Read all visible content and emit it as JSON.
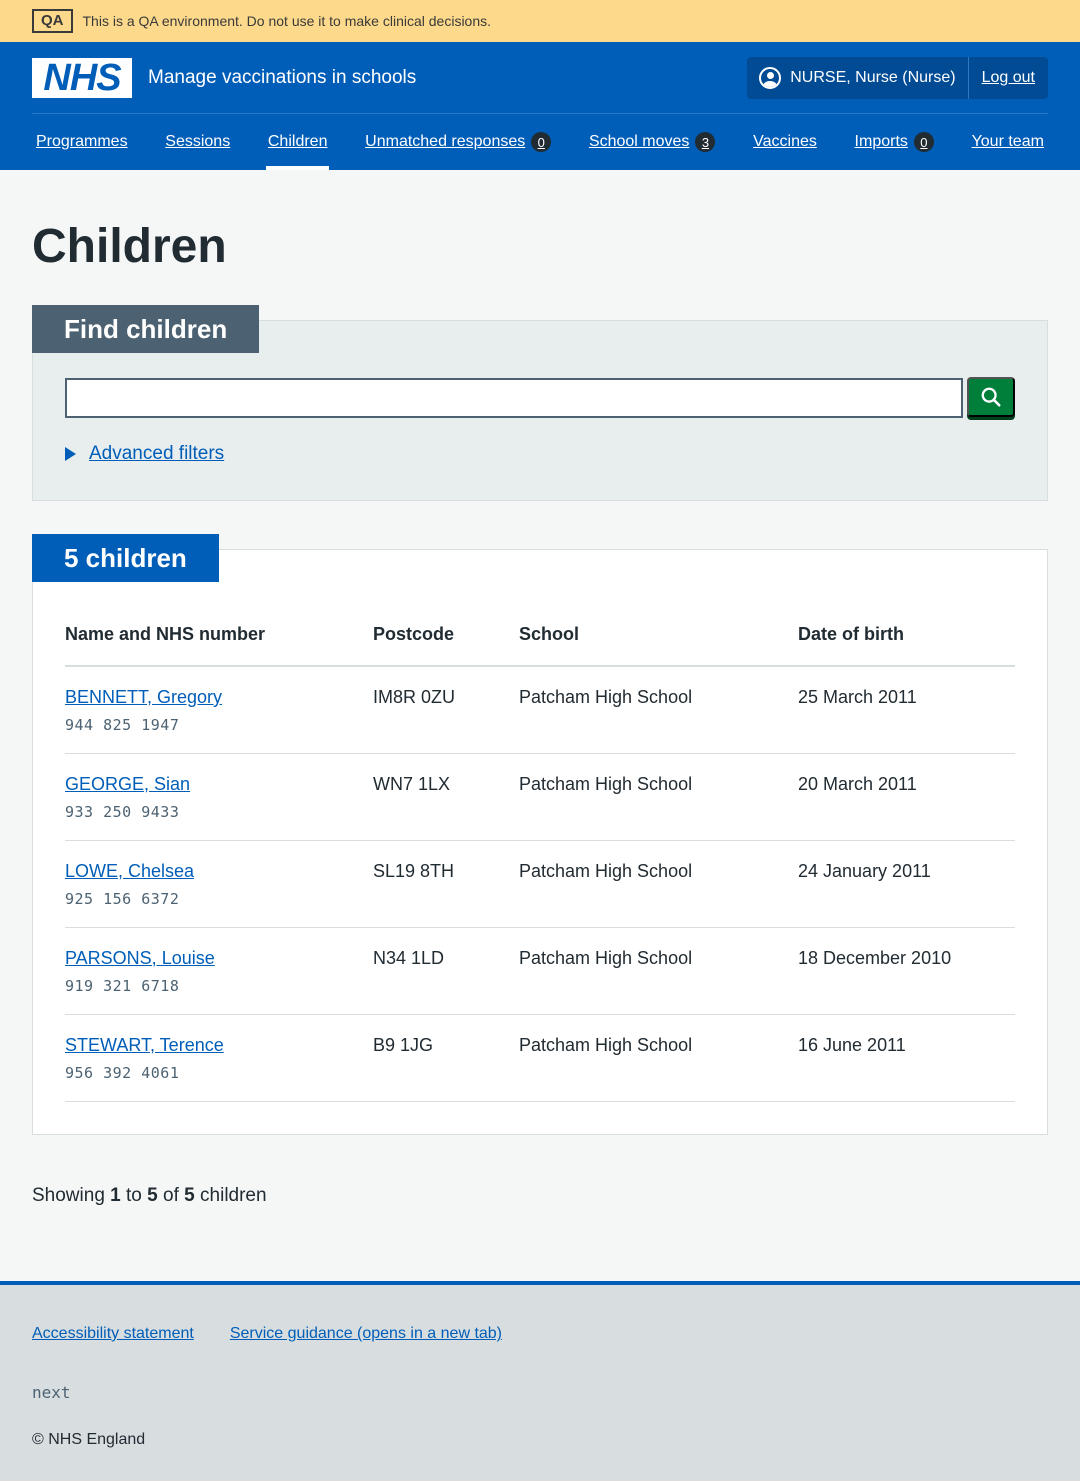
{
  "qa_banner": {
    "tag": "QA",
    "message": "This is a QA environment. Do not use it to make clinical decisions."
  },
  "header": {
    "logo": "NHS",
    "service_name": "Manage vaccinations in schools",
    "user": "NURSE, Nurse (Nurse)",
    "logout": "Log out"
  },
  "nav": {
    "items": [
      {
        "label": "Programmes"
      },
      {
        "label": "Sessions"
      },
      {
        "label": "Children",
        "active": true
      },
      {
        "label": "Unmatched responses",
        "count": "0"
      },
      {
        "label": "School moves",
        "count": "3"
      },
      {
        "label": "Vaccines"
      },
      {
        "label": "Imports",
        "count": "0"
      },
      {
        "label": "Your team"
      }
    ]
  },
  "page": {
    "title": "Children"
  },
  "filters": {
    "heading": "Find children",
    "search_value": "",
    "advanced_filters": "Advanced filters"
  },
  "results": {
    "heading": "5 children",
    "columns": [
      "Name and NHS number",
      "Postcode",
      "School",
      "Date of birth"
    ],
    "rows": [
      {
        "name": "BENNETT, Gregory",
        "nhs": "944 825 1947",
        "postcode": "IM8R 0ZU",
        "school": "Patcham High School",
        "dob": "25 March 2011"
      },
      {
        "name": "GEORGE, Sian",
        "nhs": "933 250 9433",
        "postcode": "WN7 1LX",
        "school": "Patcham High School",
        "dob": "20 March 2011"
      },
      {
        "name": "LOWE, Chelsea",
        "nhs": "925 156 6372",
        "postcode": "SL19 8TH",
        "school": "Patcham High School",
        "dob": "24 January 2011"
      },
      {
        "name": "PARSONS, Louise",
        "nhs": "919 321 6718",
        "postcode": "N34 1LD",
        "school": "Patcham High School",
        "dob": "18 December 2010"
      },
      {
        "name": "STEWART, Terence",
        "nhs": "956 392 4061",
        "postcode": "B9 1JG",
        "school": "Patcham High School",
        "dob": "16 June 2011"
      }
    ]
  },
  "pagination": {
    "prefix": "Showing",
    "from": "1",
    "to_word": "to",
    "to": "5",
    "of_word": "of",
    "total": "5",
    "suffix": "children"
  },
  "footer": {
    "links": [
      "Accessibility statement",
      "Service guidance (opens in a new tab)"
    ],
    "version": "next",
    "copyright": "© NHS England"
  },
  "colors": {
    "nhs_blue": "#005eb8",
    "qa_yellow": "#fdd98b",
    "search_green": "#007f3b",
    "heading_grey": "#4c6272"
  },
  "icons": [
    "user-icon",
    "search-icon",
    "triangle-right-icon"
  ]
}
